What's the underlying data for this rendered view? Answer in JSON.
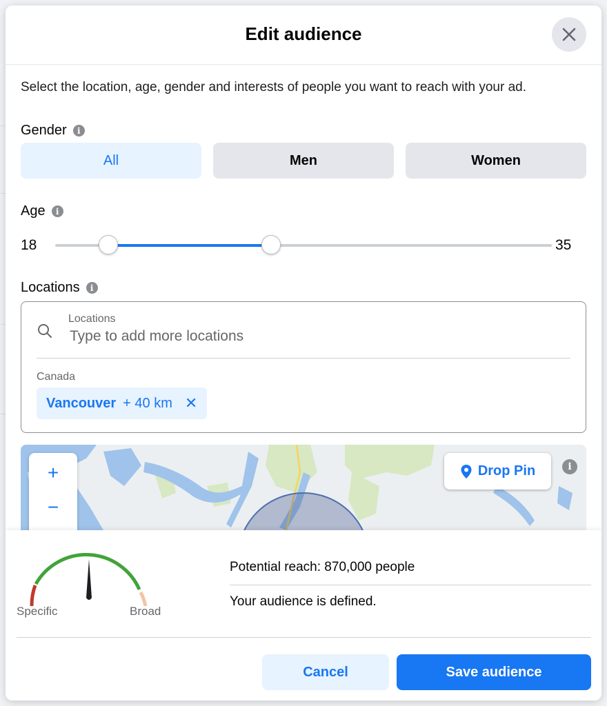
{
  "dialog": {
    "title": "Edit audience",
    "intro": "Select the location, age, gender and interests of people you want to reach with your ad."
  },
  "gender": {
    "label": "Gender",
    "options": [
      "All",
      "Men",
      "Women"
    ],
    "selected": "All"
  },
  "age": {
    "label": "Age",
    "min_label": "18",
    "max_label": "35",
    "range_min": 13,
    "range_max": 65
  },
  "locations": {
    "label": "Locations",
    "field_label": "Locations",
    "placeholder": "Type to add more locations",
    "country": "Canada",
    "selected": {
      "city": "Vancouver",
      "radius": "+ 40 km"
    }
  },
  "map": {
    "zoom_in": "+",
    "zoom_out": "−",
    "drop_pin_label": "Drop Pin"
  },
  "reach": {
    "gauge_left_label": "Specific",
    "gauge_right_label": "Broad",
    "potential_reach": "Potential reach: 870,000 people",
    "status": "Your audience is defined."
  },
  "actions": {
    "cancel_label": "Cancel",
    "save_label": "Save audience"
  },
  "colors": {
    "accent": "#1877f2",
    "accent_light": "#e7f3ff",
    "gauge_green": "#42a33a",
    "gauge_red": "#c0392b",
    "gauge_peach": "#f2c4a4"
  }
}
